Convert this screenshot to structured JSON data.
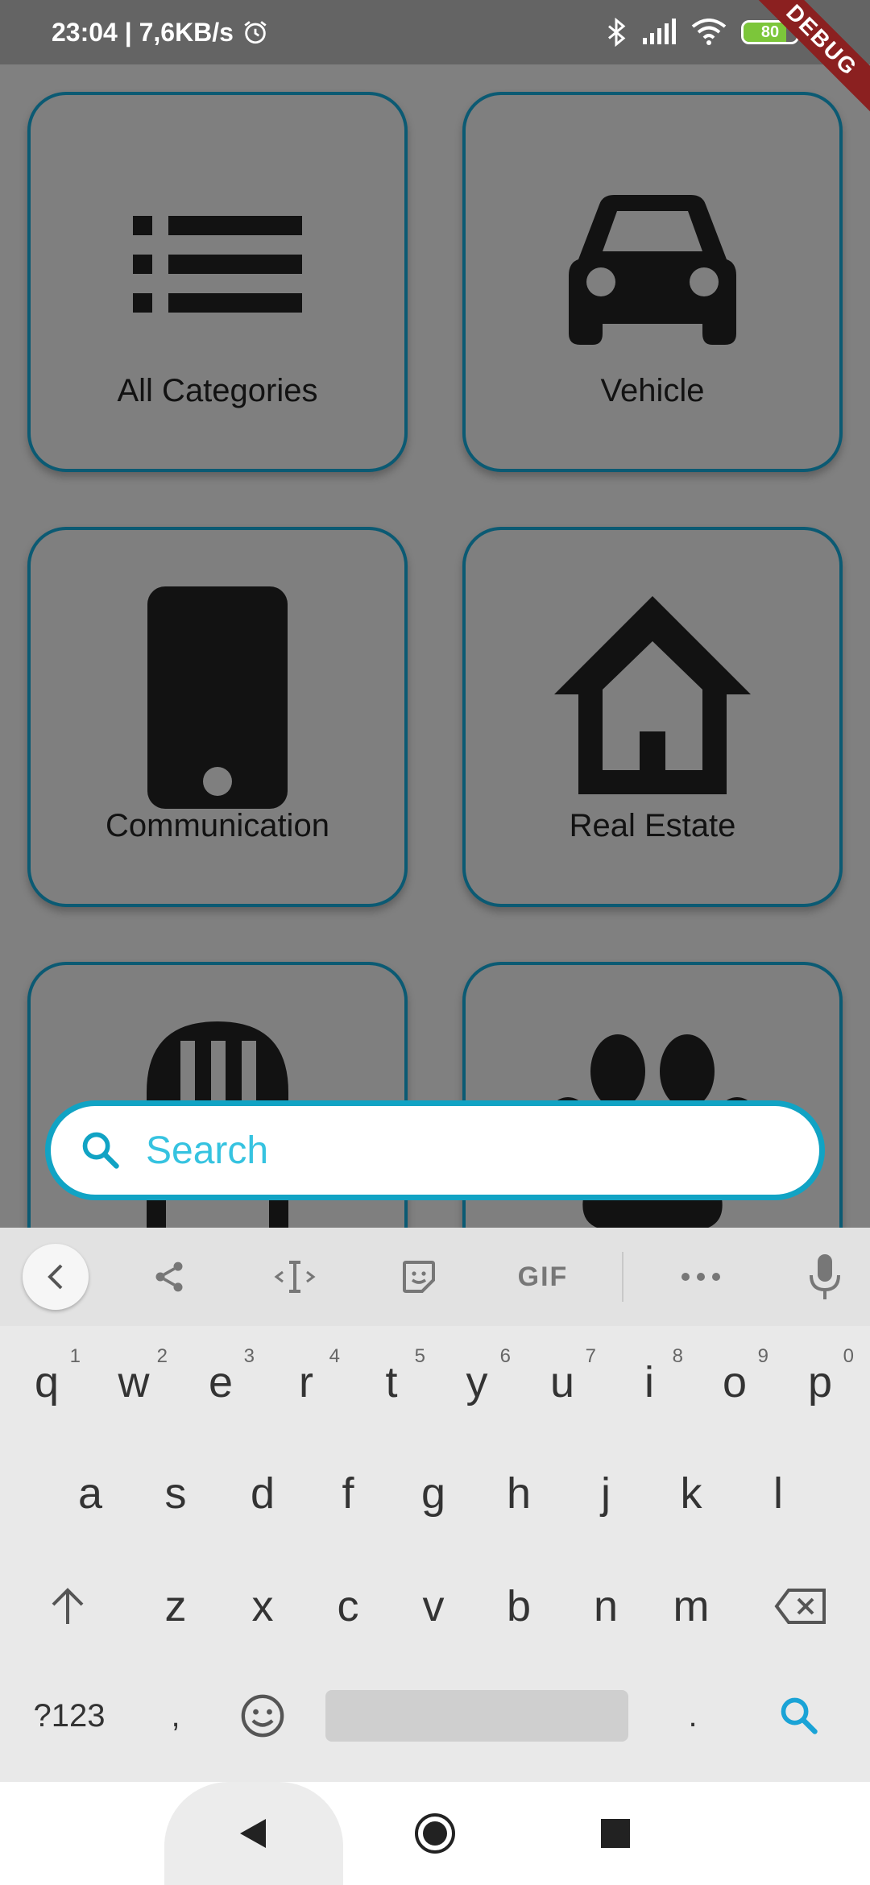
{
  "status_bar": {
    "time_speed": "23:04 | 7,6KB/s",
    "battery_level": "80",
    "battery_fraction": 0.8,
    "debug_label": "DEBUG"
  },
  "categories": [
    {
      "label": "All Categories",
      "icon": "list-icon"
    },
    {
      "label": "Vehicle",
      "icon": "car-icon"
    },
    {
      "label": "Communication",
      "icon": "smartphone-icon"
    },
    {
      "label": "Real Estate",
      "icon": "house-icon"
    },
    {
      "label": "",
      "icon": "furniture-icon"
    },
    {
      "label": "",
      "icon": "paw-icon"
    }
  ],
  "search": {
    "placeholder": "Search",
    "value": ""
  },
  "keyboard": {
    "toolbar": {
      "gif_label": "GIF"
    },
    "row1": [
      {
        "key": "q",
        "hint": "1"
      },
      {
        "key": "w",
        "hint": "2"
      },
      {
        "key": "e",
        "hint": "3"
      },
      {
        "key": "r",
        "hint": "4"
      },
      {
        "key": "t",
        "hint": "5"
      },
      {
        "key": "y",
        "hint": "6"
      },
      {
        "key": "u",
        "hint": "7"
      },
      {
        "key": "i",
        "hint": "8"
      },
      {
        "key": "o",
        "hint": "9"
      },
      {
        "key": "p",
        "hint": "0"
      }
    ],
    "row2": [
      "a",
      "s",
      "d",
      "f",
      "g",
      "h",
      "j",
      "k",
      "l"
    ],
    "row3": [
      "z",
      "x",
      "c",
      "v",
      "b",
      "n",
      "m"
    ],
    "row4": {
      "symbols": "?123",
      "comma": ",",
      "period": "."
    }
  },
  "colors": {
    "accent": "#11a3c4",
    "tile_border": "#0b5a73",
    "overlay": "#808080"
  }
}
